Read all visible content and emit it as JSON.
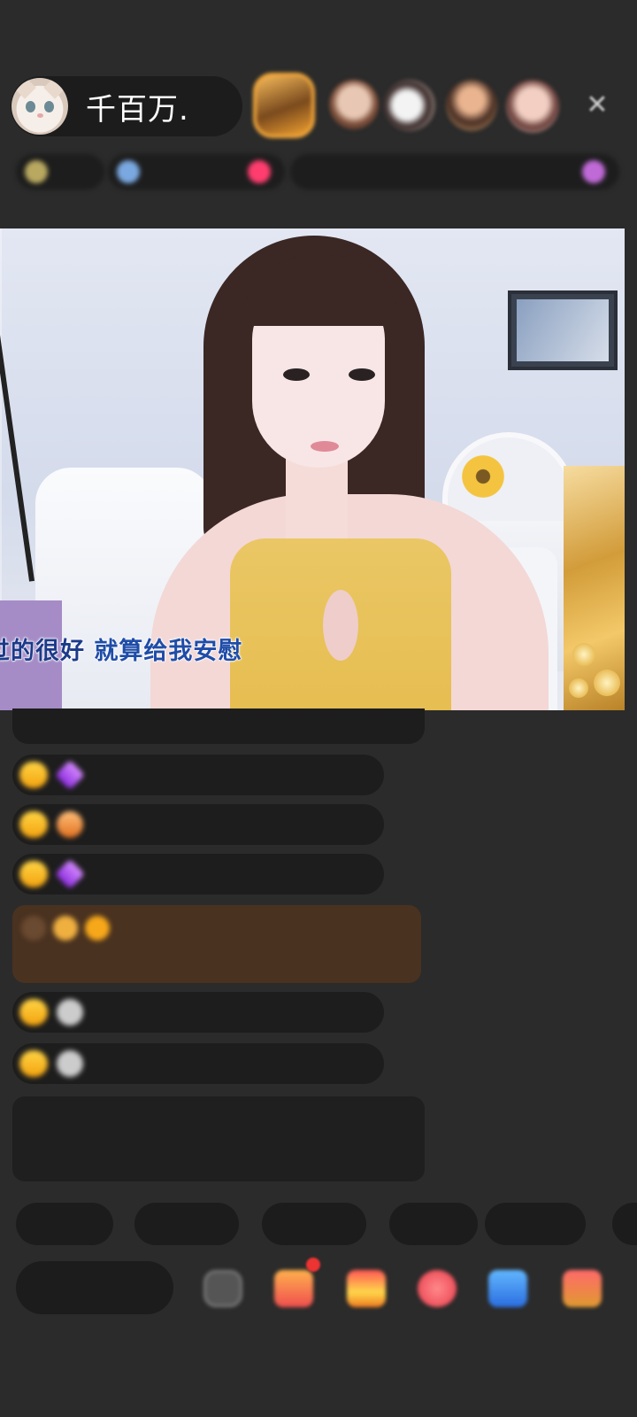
{
  "header": {
    "host_name": "千百万.",
    "info_chips": [
      "",
      "",
      ""
    ]
  },
  "video": {
    "subtitle_part1": "过的很好",
    "subtitle_part2": "就算给我安慰"
  },
  "chat": {
    "messages": [
      {
        "badge": "",
        "user": "",
        "text": ""
      },
      {
        "badge": "",
        "user": "",
        "text": ""
      },
      {
        "badge": "",
        "user": "",
        "text": ""
      },
      {
        "badge": "",
        "user": "",
        "text": ""
      },
      {
        "badge": "",
        "user": "",
        "text": ""
      },
      {
        "badge": "",
        "user": "",
        "text": ""
      }
    ],
    "system_text": ""
  },
  "quick_replies": [
    "",
    "",
    "",
    "",
    ""
  ],
  "bottom": {
    "say_placeholder": ""
  },
  "colors": {
    "background": "#2b2b2b",
    "badge_gold": "#f3a20f",
    "subtitle_blue": "#1c3a8a",
    "system_green": "#a9d55a"
  }
}
